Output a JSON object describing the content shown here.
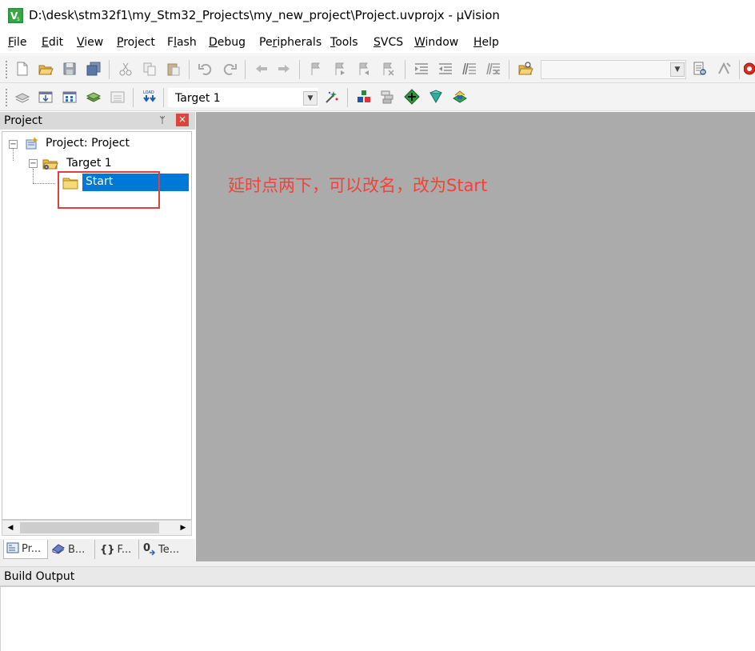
{
  "window": {
    "title": "D:\\desk\\stm32f1\\my_Stm32_Projects\\my_new_project\\Project.uvprojx - µVision",
    "icon": "uvision-app-icon"
  },
  "menu": [
    {
      "label": "File",
      "ul": "F",
      "rest": "ile"
    },
    {
      "label": "Edit",
      "ul": "E",
      "rest": "dit"
    },
    {
      "label": "View",
      "ul": "V",
      "rest": "iew"
    },
    {
      "label": "Project",
      "ul": "P",
      "rest": "roject"
    },
    {
      "label": "Flash",
      "pre": "F",
      "ul": "l",
      "rest": "ash"
    },
    {
      "label": "Debug",
      "ul": "D",
      "rest": "ebug"
    },
    {
      "label": "Peripherals",
      "pre": "Pe",
      "ul": "r",
      "rest": "ipherals"
    },
    {
      "label": "Tools",
      "ul": "T",
      "rest": "ools"
    },
    {
      "label": "SVCS",
      "ul": "S",
      "rest": "VCS"
    },
    {
      "label": "Window",
      "ul": "W",
      "rest": "indow"
    },
    {
      "label": "Help",
      "ul": "H",
      "rest": "elp"
    }
  ],
  "toolbar2": {
    "target_value": "Target 1"
  },
  "project_panel": {
    "title": "Project",
    "pin_glyph": "ᛘ",
    "close_glyph": "×",
    "tree": {
      "root_label": "Project: Project",
      "target_label": "Target 1",
      "group_label": "Start"
    },
    "tabs": [
      {
        "label": "Pr...",
        "icon": "project-tab-icon"
      },
      {
        "label": "B...",
        "icon": "books-tab-icon"
      },
      {
        "label": "F...",
        "icon": "functions-tab-icon",
        "glyph": "{}"
      },
      {
        "label": "Te...",
        "icon": "templates-tab-icon",
        "glyph": "0"
      }
    ]
  },
  "build_output": {
    "title": "Build Output"
  },
  "annotation": {
    "text": "延时点两下，可以改名，改为Start",
    "color": "#f0433a"
  },
  "colors": {
    "selection": "#0078d7",
    "editor_bg": "#ababab",
    "close_button": "#d9463c"
  }
}
